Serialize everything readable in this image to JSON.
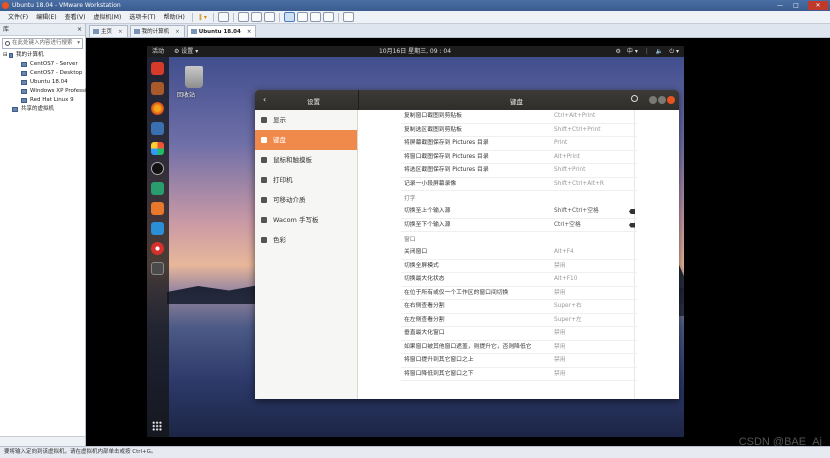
{
  "vmware": {
    "title": "Ubuntu 18.04 - VMware Workstation",
    "menu": [
      "文件(F)",
      "编辑(E)",
      "查看(V)",
      "虚拟机(M)",
      "选项卡(T)",
      "帮助(H)"
    ],
    "pause": "‖ ▾",
    "window_controls": [
      "—",
      "□",
      "✕"
    ]
  },
  "library": {
    "title": "库",
    "close": "×",
    "search_placeholder": "在此处键入内容进行搜索",
    "root": "我的计算机",
    "vms": [
      "CentOS7 - Server",
      "CentOS7 - Desktop",
      "Ubuntu 18.04",
      "Windows XP Professi",
      "Red Hat Linux 9"
    ],
    "shared": "共享的虚拟机"
  },
  "tabs": [
    {
      "label": "主页",
      "close": "×"
    },
    {
      "label": "我的计算机",
      "close": "×"
    },
    {
      "label": "Ubuntu 18.04",
      "close": "×"
    }
  ],
  "ubuntu": {
    "activities": "活动",
    "app_menu": "⚙ 设置 ▾",
    "clock": "10月16日 星期三, 09 : 04",
    "tray": [
      "⚙",
      "中 ▾",
      "⋮",
      "🔈",
      "⏻ ▾"
    ],
    "trash_label": "回收站"
  },
  "settings": {
    "back": "‹",
    "left_title": "设置",
    "right_title": "键盘",
    "sidebar": [
      {
        "label": "显示",
        "active": false
      },
      {
        "label": "键盘",
        "active": true
      },
      {
        "label": "鼠标和触摸板",
        "active": false
      },
      {
        "label": "打印机",
        "active": false
      },
      {
        "label": "可移动介质",
        "active": false
      },
      {
        "label": "Wacom 手写板",
        "active": false
      },
      {
        "label": "色彩",
        "active": false
      }
    ],
    "screenshot_rows": [
      {
        "name": "复制窗口截图到剪贴板",
        "shortcut": "Ctrl+Alt+Print"
      },
      {
        "name": "复制选区截图到剪贴板",
        "shortcut": "Shift+Ctrl+Print"
      },
      {
        "name": "将屏幕截图保存到 Pictures 目录",
        "shortcut": "Print"
      },
      {
        "name": "将窗口截图保存到 Pictures 目录",
        "shortcut": "Alt+Print"
      },
      {
        "name": "将选区截图保存到 Pictures 目录",
        "shortcut": "Shift+Print"
      },
      {
        "name": "记录一小段屏幕录像",
        "shortcut": "Shift+Ctrl+Alt+R"
      }
    ],
    "typing_section": "打字",
    "typing_rows": [
      {
        "name": "切换至上个输入源",
        "shortcut": "Shift+Ctrl+空格"
      },
      {
        "name": "切换至下个输入源",
        "shortcut": "Ctrl+空格"
      }
    ],
    "window_section": "窗口",
    "window_rows": [
      {
        "name": "关闭窗口",
        "shortcut": "Alt+F4"
      },
      {
        "name": "切换全屏模式",
        "shortcut": "禁用"
      },
      {
        "name": "切换最大化状态",
        "shortcut": "Alt+F10"
      },
      {
        "name": "在位于所有或仅一个工作区的窗口间切换",
        "shortcut": "禁用"
      },
      {
        "name": "在右侧查看分割",
        "shortcut": "Super+右"
      },
      {
        "name": "在左侧查看分割",
        "shortcut": "Super+左"
      },
      {
        "name": "垂直最大化窗口",
        "shortcut": "禁用"
      },
      {
        "name": "如果窗口被其他窗口遮盖，则提升它，否则降低它",
        "shortcut": "禁用"
      },
      {
        "name": "将窗口提升到其它窗口之上",
        "shortcut": "禁用"
      },
      {
        "name": "将窗口降低到其它窗口之下",
        "shortcut": "禁用"
      }
    ]
  },
  "statusbar": "要将输入定向到该虚拟机，请在虚拟机内部单击或按 Ctrl+G。",
  "watermark": "CSDN @BAE_Aj",
  "colors": {
    "accent": "#f08a4b",
    "ubuntu_orange": "#e95420",
    "topbar": "#1d1d1d"
  }
}
